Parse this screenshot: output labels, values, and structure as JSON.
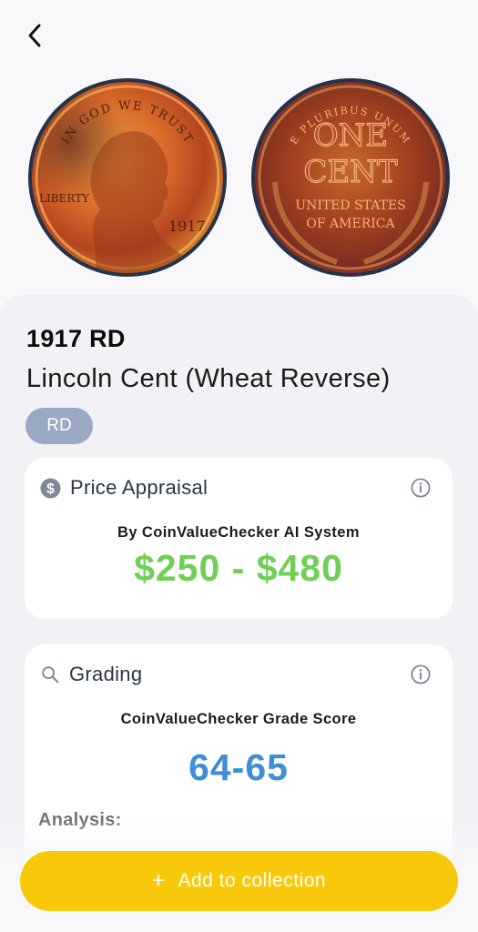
{
  "nav": {
    "back_icon": "chevron-left-icon"
  },
  "coin": {
    "year_label": "1917 RD",
    "name": "Lincoln Cent (Wheat Reverse)",
    "grade_badge": "RD",
    "obverse": {
      "top_text": "IN GOD WE TRUST",
      "side_text": "LIBERTY",
      "date_text": "1917"
    },
    "reverse": {
      "top_text": "E PLURIBUS UNUM",
      "line1": "ONE",
      "line2": "CENT",
      "line3": "UNITED STATES",
      "line4": "OF AMERICA"
    }
  },
  "price_card": {
    "icon": "dollar-circle-icon",
    "title": "Price Appraisal",
    "subtitle": "By CoinValueChecker AI System",
    "value": "$250 - $480"
  },
  "grading_card": {
    "icon": "search-icon",
    "title": "Grading",
    "subtitle": "CoinValueChecker Grade Score",
    "value": "64-65",
    "analysis_label": "Analysis:"
  },
  "footer": {
    "add_icon": "+",
    "add_label": "Add to collection"
  },
  "colors": {
    "accent_yellow": "#f7c90a",
    "price_green": "#6fd055",
    "grade_blue": "#3f8ed6",
    "badge_bg": "#9aaac4"
  }
}
